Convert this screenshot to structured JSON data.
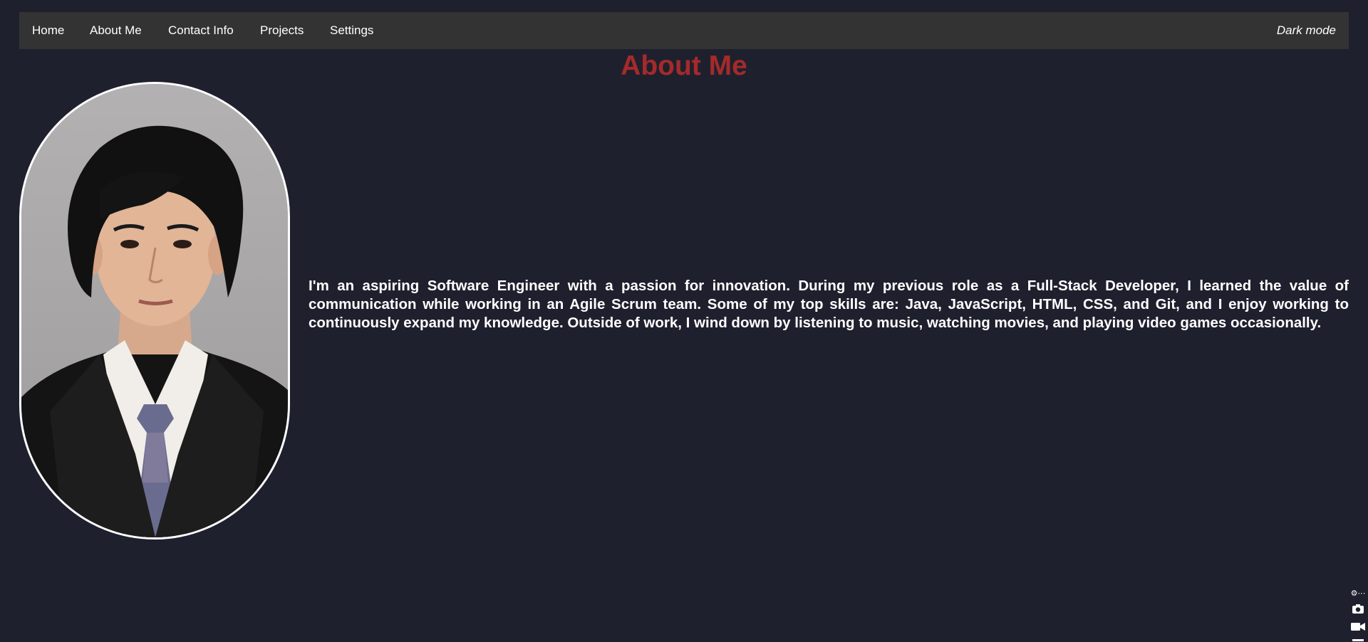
{
  "nav": {
    "home": "Home",
    "about": "About Me",
    "contact": "Contact Info",
    "projects": "Projects",
    "settings": "Settings",
    "dark_mode": "Dark mode"
  },
  "main": {
    "title": "About Me",
    "bio": "I'm an aspiring Software Engineer with a passion for innovation. During my previous role as a Full-Stack Developer, I learned the value of communication while working in an Agile Scrum team. Some of my top skills are: Java, JavaScript, HTML, CSS, and Git, and I enjoy working to continuously expand my knowledge. Outside of work, I wind down by listening to music, watching movies, and playing video games occasionally."
  },
  "colors": {
    "background": "#1f202e",
    "navbar": "#333333",
    "title": "#a52a2a",
    "text": "#ffffff"
  },
  "icons": {
    "tool_more": "more-icon",
    "tool_camera": "camera-icon",
    "tool_video": "video-icon"
  }
}
